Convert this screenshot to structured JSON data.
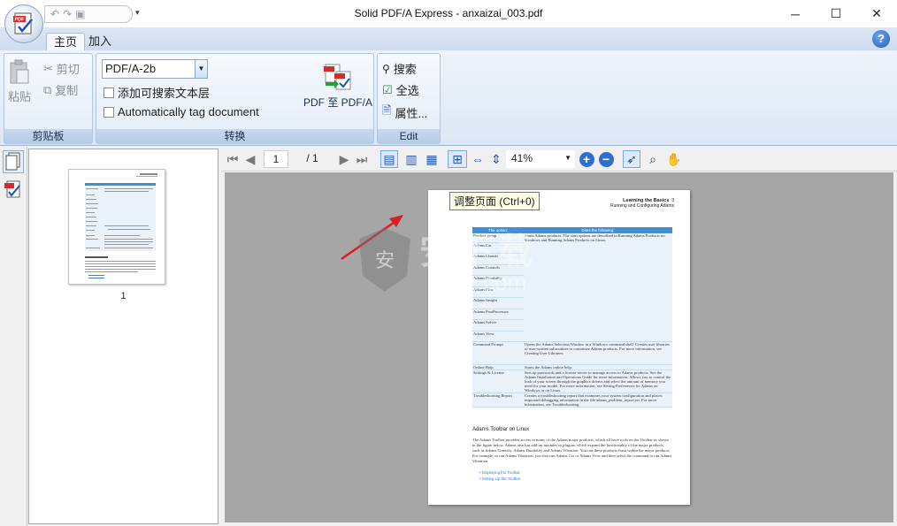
{
  "window": {
    "title": "Solid PDF/A Express - anxaizai_003.pdf",
    "minimize": "─",
    "maximize": "☐",
    "close": "✕"
  },
  "quick_access": {
    "undo": "↶",
    "redo": "↷",
    "save": "▣",
    "dropdown": "▾"
  },
  "ribbon_tabs": [
    {
      "label": "主页",
      "active": true
    },
    {
      "label": "加入",
      "active": false
    }
  ],
  "help_label": "?",
  "clipboard_group": {
    "label": "剪贴板",
    "paste": "粘贴",
    "cut": "剪切",
    "copy": "复制"
  },
  "convert_group": {
    "label": "转换",
    "format_value": "PDF/A-2b",
    "add_searchable_text": "添加可搜索文本层",
    "auto_tag": "Automatically tag document",
    "convert_button": "PDF 至 PDF/A"
  },
  "edit_group": {
    "label": "Edit",
    "search": "搜索",
    "select_all": "全选",
    "properties": "属性..."
  },
  "navigation": {
    "current_page": "1",
    "total_pages": "/ 1",
    "zoom": "41%"
  },
  "thumbnails": [
    {
      "page_number": "1"
    }
  ],
  "tooltip": "调整页面 (Ctrl+0)",
  "document_page": {
    "header_title": "Learning the Basics",
    "header_subtitle": "Running and Configuring Adams",
    "header_page": "3",
    "table_headers": [
      "The option:",
      "Does the following:"
    ],
    "table_rows": [
      [
        "Product group",
        "Starts Adams products. The start options are described in Running Adams Products on Windows and Running Adams Products on Linux."
      ],
      [
        "Adams Car",
        ""
      ],
      [
        "Adams Chassis",
        ""
      ],
      [
        "Adams Controls",
        ""
      ],
      [
        "Adams Durability",
        ""
      ],
      [
        "Adams Flex",
        ""
      ],
      [
        "Adams Insight",
        ""
      ],
      [
        "Adams PostProcessor",
        ""
      ],
      [
        "Adams Solver",
        ""
      ],
      [
        "Adams View",
        ""
      ],
      [
        "Command Prompt",
        "Opens the Adams Selection Window in a Windows command shell. Creates user libraries of user-written subroutines to customize Adams products. For more information, see Creating User Libraries."
      ],
      [
        "Online Help",
        "Starts the Adams online help."
      ],
      [
        "Settings & License",
        "Sets up passwords and a license server to manage access to Adams products. See the Adams Installation and Operations Guide for more information. Allows you to control the look of your screen through the graphics drivers and select the amount of memory you need for your model. For more information, see Setting Preferences for Adams on Windows or on Linux."
      ],
      [
        "Troubleshooting Report",
        "Creates a troubleshooting report that examines your system configuration and places important debugging information in the file adams_problem_report.txt. For more information, see Troubleshooting."
      ]
    ],
    "section_title": "Adams Toolbar on Linux",
    "section_body": "The Adams Toolbar provides access to many of the Adams major products, which all have tools on the Toolbar as shown in the figure below. Adams also has add-on modules or plugins, which expand the functionality of the major products, such as Adams Controls, Adams Durability and Adams Vibration. You run these products from within the major products. For example, to run Adams Vibration, you first run Adams Car or Adams View and then select the command to run Adams Vibration.",
    "links": [
      "Displaying the Toolbar",
      "Setting Up the Toolbar"
    ]
  },
  "watermark_text": "安下载",
  "watermark_sub": "anxz.com",
  "colors": {
    "ribbon": "#dce7f5",
    "accent": "#3f8fd9",
    "viewer_bg": "#a6a6a6"
  }
}
